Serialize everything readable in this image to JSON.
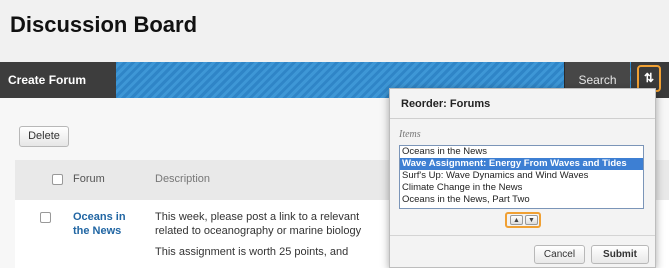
{
  "page": {
    "title": "Discussion Board"
  },
  "action_bar": {
    "create_forum_label": "Create Forum",
    "search_label": "Search",
    "sort_icon": "⇅"
  },
  "toolbar": {
    "delete_label": "Delete"
  },
  "table": {
    "columns": [
      "Forum",
      "Description"
    ],
    "rows": [
      {
        "forum": "Oceans in the News",
        "description": "This week, please post a link to a relevant",
        "description_line2": "related to oceanography or marine biology",
        "description_extra": "This assignment is worth 25 points, and"
      }
    ]
  },
  "reorder_popup": {
    "title": "Reorder: Forums",
    "items_label": "Items",
    "items": [
      "Oceans in the News",
      "Wave Assignment: Energy From Waves and Tides",
      "Surf's Up: Wave Dynamics and Wind Waves",
      "Climate Change in the News",
      "Oceans in the News, Part Two"
    ],
    "selected_item": "Wave Assignment: Energy From Waves and Tides",
    "move_up_glyph": "▲",
    "move_down_glyph": "▼",
    "cancel_label": "Cancel",
    "submit_label": "Submit"
  },
  "colors": {
    "action_bar_blue": "#3e97d6",
    "highlight_orange": "#f0a033",
    "link_blue": "#2166a3",
    "selected_blue": "#3d7fd3"
  }
}
